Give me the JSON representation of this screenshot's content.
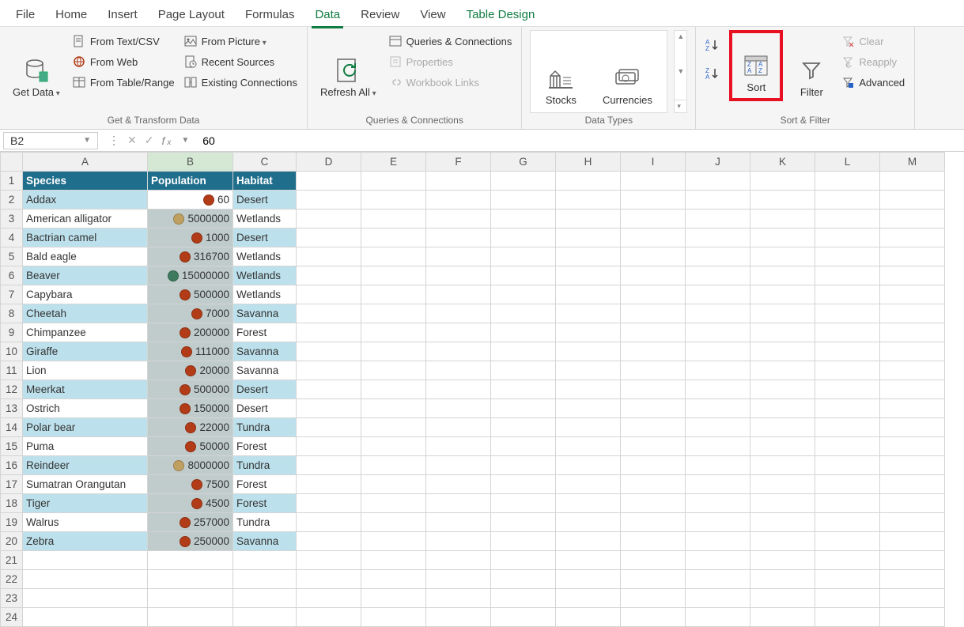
{
  "menu": {
    "items": [
      "File",
      "Home",
      "Insert",
      "Page Layout",
      "Formulas",
      "Data",
      "Review",
      "View",
      "Table Design"
    ],
    "active": "Data"
  },
  "ribbon": {
    "get_transform": {
      "label": "Get & Transform Data",
      "get_data": "Get Data",
      "from_text": "From Text/CSV",
      "from_web": "From Web",
      "from_table": "From Table/Range",
      "from_picture": "From Picture",
      "recent_sources": "Recent Sources",
      "existing_conn": "Existing Connections"
    },
    "queries": {
      "label": "Queries & Connections",
      "refresh_all": "Refresh All",
      "queries_conn": "Queries & Connections",
      "properties": "Properties",
      "workbook_links": "Workbook Links"
    },
    "data_types": {
      "label": "Data Types",
      "stocks": "Stocks",
      "currencies": "Currencies"
    },
    "sort_filter": {
      "label": "Sort & Filter",
      "sort": "Sort",
      "filter": "Filter",
      "clear": "Clear",
      "reapply": "Reapply",
      "advanced": "Advanced"
    }
  },
  "formula_bar": {
    "name_box": "B2",
    "formula": "60"
  },
  "columns": [
    "A",
    "B",
    "C",
    "D",
    "E",
    "F",
    "G",
    "H",
    "I",
    "J",
    "K",
    "L",
    "M"
  ],
  "col_widths": {
    "A": 158,
    "B": 108,
    "C": 80,
    "other": 82
  },
  "headers": {
    "A": "Species",
    "B": "Population",
    "C": "Habitat"
  },
  "rows": [
    {
      "species": "Addax",
      "pop": 60,
      "pop_text": "60",
      "hab": "Desert",
      "dot": "#b23c17",
      "band": "even",
      "active": true
    },
    {
      "species": "American alligator",
      "pop": 5000000,
      "pop_text": "5000000",
      "hab": "Wetlands",
      "dot": "#c0a060",
      "band": "odd"
    },
    {
      "species": "Bactrian camel",
      "pop": 1000,
      "pop_text": "1000",
      "hab": "Desert",
      "dot": "#b23c17",
      "band": "even"
    },
    {
      "species": "Bald eagle",
      "pop": 316700,
      "pop_text": "316700",
      "hab": "Wetlands",
      "dot": "#b23c17",
      "band": "odd"
    },
    {
      "species": "Beaver",
      "pop": 15000000,
      "pop_text": "15000000",
      "hab": "Wetlands",
      "dot": "#3e7a5e",
      "band": "even"
    },
    {
      "species": "Capybara",
      "pop": 500000,
      "pop_text": "500000",
      "hab": "Wetlands",
      "dot": "#b23c17",
      "band": "odd"
    },
    {
      "species": "Cheetah",
      "pop": 7000,
      "pop_text": "7000",
      "hab": "Savanna",
      "dot": "#b23c17",
      "band": "even"
    },
    {
      "species": "Chimpanzee",
      "pop": 200000,
      "pop_text": "200000",
      "hab": "Forest",
      "dot": "#b23c17",
      "band": "odd"
    },
    {
      "species": "Giraffe",
      "pop": 111000,
      "pop_text": "111000",
      "hab": "Savanna",
      "dot": "#b23c17",
      "band": "even"
    },
    {
      "species": "Lion",
      "pop": 20000,
      "pop_text": "20000",
      "hab": "Savanna",
      "dot": "#b23c17",
      "band": "odd"
    },
    {
      "species": "Meerkat",
      "pop": 500000,
      "pop_text": "500000",
      "hab": "Desert",
      "dot": "#b23c17",
      "band": "even"
    },
    {
      "species": "Ostrich",
      "pop": 150000,
      "pop_text": "150000",
      "hab": "Desert",
      "dot": "#b23c17",
      "band": "odd"
    },
    {
      "species": "Polar bear",
      "pop": 22000,
      "pop_text": "22000",
      "hab": "Tundra",
      "dot": "#b23c17",
      "band": "even"
    },
    {
      "species": "Puma",
      "pop": 50000,
      "pop_text": "50000",
      "hab": "Forest",
      "dot": "#b23c17",
      "band": "odd"
    },
    {
      "species": "Reindeer",
      "pop": 8000000,
      "pop_text": "8000000",
      "hab": "Tundra",
      "dot": "#c0a060",
      "band": "even"
    },
    {
      "species": "Sumatran Orangutan",
      "pop": 7500,
      "pop_text": "7500",
      "hab": "Forest",
      "dot": "#b23c17",
      "band": "odd"
    },
    {
      "species": "Tiger",
      "pop": 4500,
      "pop_text": "4500",
      "hab": "Forest",
      "dot": "#b23c17",
      "band": "even"
    },
    {
      "species": "Walrus",
      "pop": 257000,
      "pop_text": "257000",
      "hab": "Tundra",
      "dot": "#b23c17",
      "band": "odd"
    },
    {
      "species": "Zebra",
      "pop": 250000,
      "pop_text": "250000",
      "hab": "Savanna",
      "dot": "#b23c17",
      "band": "even"
    }
  ],
  "blank_rows": 4
}
